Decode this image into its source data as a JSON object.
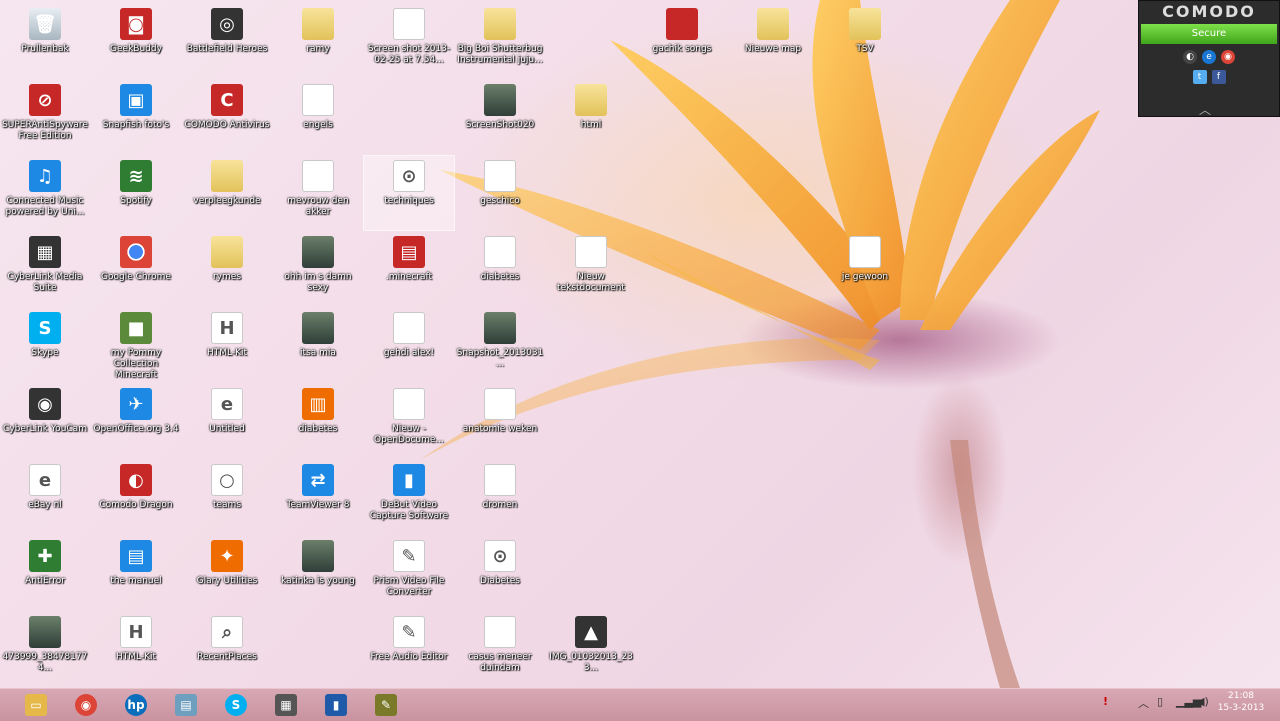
{
  "desktop": {
    "icons": [
      {
        "label": "Prullenbak",
        "kind": "k-bin",
        "glyph": "🗑"
      },
      {
        "label": "SUPERAntiSpyware Free Edition",
        "kind": "k-red",
        "glyph": "⊘"
      },
      {
        "label": "Connected Music powered by Uni...",
        "kind": "k-blue",
        "glyph": "♫"
      },
      {
        "label": "CyberLink Media Suite",
        "kind": "k-dark",
        "glyph": "▦"
      },
      {
        "label": "Skype",
        "kind": "k-skype",
        "glyph": "S"
      },
      {
        "label": "CyberLink YouCam",
        "kind": "k-dark",
        "glyph": "◉"
      },
      {
        "label": "eBay nl",
        "kind": "k-doc",
        "glyph": "e"
      },
      {
        "label": "AntiError",
        "kind": "k-green",
        "glyph": "✚"
      },
      {
        "label": "473999_384781774...",
        "kind": "k-photo",
        "glyph": ""
      },
      {
        "label": "GeekBuddy",
        "kind": "k-red",
        "glyph": "◙"
      },
      {
        "label": "Snapfish foto's",
        "kind": "k-blue",
        "glyph": "▣"
      },
      {
        "label": "Spotify",
        "kind": "k-green",
        "glyph": "≋"
      },
      {
        "label": "Google Chrome",
        "kind": "k-chrome",
        "glyph": ""
      },
      {
        "label": "my Pommy Collection Minecraft",
        "kind": "k-mine",
        "glyph": "■"
      },
      {
        "label": "OpenOffice.org 3.4",
        "kind": "k-blue",
        "glyph": "✈"
      },
      {
        "label": "Comodo Dragon",
        "kind": "k-red",
        "glyph": "◐"
      },
      {
        "label": "the manuel",
        "kind": "k-blue",
        "glyph": "▤"
      },
      {
        "label": "HTML-Kit",
        "kind": "k-doc",
        "glyph": "H"
      },
      {
        "label": "Battlefield Heroes",
        "kind": "k-dark",
        "glyph": "◎"
      },
      {
        "label": "COMODO Antivirus",
        "kind": "k-red",
        "glyph": "C"
      },
      {
        "label": "verpleegkunde",
        "kind": "k-folder",
        "glyph": ""
      },
      {
        "label": "rymes",
        "kind": "k-folder",
        "glyph": ""
      },
      {
        "label": "HTML-Kit",
        "kind": "k-doc",
        "glyph": "H"
      },
      {
        "label": "Untitled",
        "kind": "k-ie",
        "glyph": "e"
      },
      {
        "label": "teams",
        "kind": "k-doc",
        "glyph": "○"
      },
      {
        "label": "Glary Utilities",
        "kind": "k-orange",
        "glyph": "✦"
      },
      {
        "label": "RecentPlaces",
        "kind": "k-doc",
        "glyph": "⌕"
      },
      {
        "label": "ramy",
        "kind": "k-folder",
        "glyph": ""
      },
      {
        "label": "engels",
        "kind": "k-doc",
        "glyph": ""
      },
      {
        "label": "mevrouw den akker",
        "kind": "k-doc",
        "glyph": ""
      },
      {
        "label": "ohh im s damn sexy",
        "kind": "k-photo",
        "glyph": ""
      },
      {
        "label": "itsa mia",
        "kind": "k-photo",
        "glyph": ""
      },
      {
        "label": "diabetes",
        "kind": "k-orange",
        "glyph": "▥"
      },
      {
        "label": "TeamViewer 8",
        "kind": "k-blue",
        "glyph": "⇄"
      },
      {
        "label": "katinka is young",
        "kind": "k-photo",
        "glyph": ""
      },
      {
        "label": "Screen shot 2013-02-25 at 7.54...",
        "kind": "k-doc",
        "glyph": ""
      },
      {
        "label": "techniques",
        "kind": "k-doc",
        "glyph": "⊙"
      },
      {
        "label": ".minecraft",
        "kind": "k-red",
        "glyph": "▤"
      },
      {
        "label": "gehdi alex!",
        "kind": "k-doc",
        "glyph": ""
      },
      {
        "label": "Nieuw - OpenDocume...",
        "kind": "k-doc",
        "glyph": ""
      },
      {
        "label": "DeBut Video Capture Software",
        "kind": "k-blue",
        "glyph": "▮"
      },
      {
        "label": "Prism Video File Converter",
        "kind": "k-doc",
        "glyph": "✎"
      },
      {
        "label": "Free Audio Editor",
        "kind": "k-doc",
        "glyph": "✎"
      },
      {
        "label": "Big Boi Shutterbug Instrumental juju...",
        "kind": "k-folder",
        "glyph": ""
      },
      {
        "label": "ScreenShot020",
        "kind": "k-photo",
        "glyph": ""
      },
      {
        "label": "geschico",
        "kind": "k-doc",
        "glyph": ""
      },
      {
        "label": "diabetes",
        "kind": "k-doc",
        "glyph": ""
      },
      {
        "label": "Snapshot_2013031...",
        "kind": "k-photo",
        "glyph": ""
      },
      {
        "label": "anatomie weken",
        "kind": "k-doc",
        "glyph": ""
      },
      {
        "label": "dromen",
        "kind": "k-doc",
        "glyph": ""
      },
      {
        "label": "Diabetes",
        "kind": "k-doc",
        "glyph": "⊙"
      },
      {
        "label": "casus meneer duindam",
        "kind": "k-doc",
        "glyph": ""
      },
      {
        "label": "html",
        "kind": "k-folder",
        "glyph": ""
      },
      {
        "label": "Nieuw tekstdocument",
        "kind": "k-doc",
        "glyph": ""
      },
      {
        "label": "IMG_01032013_233...",
        "kind": "k-dark",
        "glyph": "▲"
      },
      {
        "label": "gachik songs",
        "kind": "k-red",
        "glyph": ""
      },
      {
        "label": "Nieuwe map",
        "kind": "k-folder",
        "glyph": ""
      },
      {
        "label": "TSV",
        "kind": "k-folder",
        "glyph": ""
      },
      {
        "label": "je gewoon",
        "kind": "k-doc",
        "glyph": ""
      }
    ]
  },
  "comodo": {
    "title": "COMODO",
    "status": "Secure",
    "collapse_glyph": "︿"
  },
  "taskbar": {
    "apps": [
      {
        "name": "file-explorer",
        "glyph": "▭",
        "color": "#e6b84a"
      },
      {
        "name": "chrome",
        "glyph": "◉",
        "color": "#db4437"
      },
      {
        "name": "hp",
        "glyph": "hp",
        "color": "#0a6ebd"
      },
      {
        "name": "notebook",
        "glyph": "▤",
        "color": "#6f9fbf"
      },
      {
        "name": "skype",
        "glyph": "S",
        "color": "#00aff0"
      },
      {
        "name": "document-manager",
        "glyph": "▦",
        "color": "#555555"
      },
      {
        "name": "video-capture",
        "glyph": "▮",
        "color": "#1e5aa8"
      },
      {
        "name": "video-converter",
        "glyph": "✎",
        "color": "#7a7a2a"
      }
    ],
    "tray": {
      "clock_time": "21:08",
      "clock_date": "15-3-2013"
    }
  }
}
